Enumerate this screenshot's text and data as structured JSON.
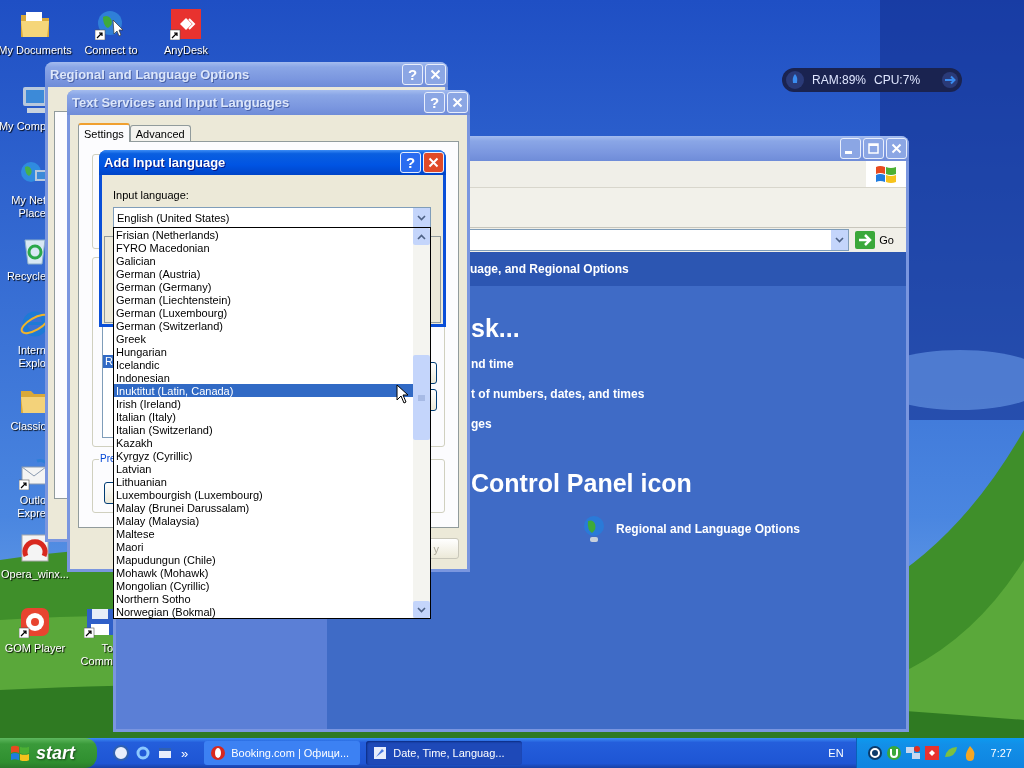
{
  "desktop_icons": [
    {
      "lines": [
        "My Documents"
      ],
      "kind": "documents",
      "shortcut": false
    },
    {
      "lines": [
        "Connect to"
      ],
      "kind": "connect",
      "shortcut": true
    },
    {
      "lines": [
        "AnyDesk"
      ],
      "kind": "anydesk",
      "shortcut": true
    },
    {
      "lines": [
        "My Comp"
      ],
      "kind": "computer",
      "shortcut": false
    },
    {
      "lines": [
        "My Net",
        "Place"
      ],
      "kind": "network",
      "shortcut": false
    },
    {
      "lines": [
        "Recycle"
      ],
      "kind": "recycle",
      "shortcut": false
    },
    {
      "lines": [
        "Intern",
        "Explo"
      ],
      "kind": "ie",
      "shortcut": false
    },
    {
      "lines": [
        "Classic"
      ],
      "kind": "folder",
      "shortcut": false
    },
    {
      "lines": [
        "Outlo",
        "Expre"
      ],
      "kind": "outlook",
      "shortcut": true
    },
    {
      "lines": [
        "Opera_winx..."
      ],
      "kind": "opera",
      "shortcut": false
    },
    {
      "lines": [
        "GOM Player"
      ],
      "kind": "gom",
      "shortcut": true
    },
    {
      "lines": [
        "To",
        "Comm"
      ],
      "kind": "commander",
      "shortcut": true
    }
  ],
  "system_monitor": {
    "ram": "RAM:89%",
    "cpu": "CPU:7%"
  },
  "control_panel_window": {
    "active": false,
    "go_button": "Go",
    "header": "uage, and Regional Options",
    "task_heading": "sk...",
    "tasks": [
      "nd time",
      "t of numbers, dates, and times",
      "ges"
    ],
    "icon_heading": "Control Panel icon",
    "icon_link": "Regional and Language Options"
  },
  "regional_window": {
    "title": "Regional and Language Options",
    "active": false,
    "help": "?"
  },
  "text_services_window": {
    "title": "Text Services and Input Languages",
    "active": false,
    "help": "?",
    "tabs": [
      {
        "label": "Settings",
        "selected": true
      },
      {
        "label": "Advanced",
        "selected": false
      }
    ],
    "installed_item": {
      "label": "R",
      "selected": true
    },
    "preferences_label": "Pre",
    "apply_button": {
      "label": "y",
      "disabled": true
    }
  },
  "add_dialog": {
    "title": "Add Input language",
    "active": true,
    "help": "?",
    "field_label": "Input language:",
    "value": "English (United States)",
    "options": [
      {
        "label": "Frisian (Netherlands)",
        "selected": false
      },
      {
        "label": "FYRO Macedonian",
        "selected": false
      },
      {
        "label": "Galician",
        "selected": false
      },
      {
        "label": "German (Austria)",
        "selected": false
      },
      {
        "label": "German (Germany)",
        "selected": false
      },
      {
        "label": "German (Liechtenstein)",
        "selected": false
      },
      {
        "label": "German (Luxembourg)",
        "selected": false
      },
      {
        "label": "German (Switzerland)",
        "selected": false
      },
      {
        "label": "Greek",
        "selected": false
      },
      {
        "label": "Hungarian",
        "selected": false
      },
      {
        "label": "Icelandic",
        "selected": false
      },
      {
        "label": "Indonesian",
        "selected": false
      },
      {
        "label": "Inuktitut (Latin, Canada)",
        "selected": true
      },
      {
        "label": "Irish (Ireland)",
        "selected": false
      },
      {
        "label": "Italian (Italy)",
        "selected": false
      },
      {
        "label": "Italian (Switzerland)",
        "selected": false
      },
      {
        "label": "Kazakh",
        "selected": false
      },
      {
        "label": "Kyrgyz (Cyrillic)",
        "selected": false
      },
      {
        "label": "Latvian",
        "selected": false
      },
      {
        "label": "Lithuanian",
        "selected": false
      },
      {
        "label": "Luxembourgish (Luxembourg)",
        "selected": false
      },
      {
        "label": "Malay (Brunei Darussalam)",
        "selected": false
      },
      {
        "label": "Malay (Malaysia)",
        "selected": false
      },
      {
        "label": "Maltese",
        "selected": false
      },
      {
        "label": "Maori",
        "selected": false
      },
      {
        "label": "Mapudungun (Chile)",
        "selected": false
      },
      {
        "label": "Mohawk (Mohawk)",
        "selected": false
      },
      {
        "label": "Mongolian (Cyrillic)",
        "selected": false
      },
      {
        "label": "Northern Sotho",
        "selected": false
      },
      {
        "label": "Norwegian (Bokmal)",
        "selected": false
      }
    ]
  },
  "taskbar": {
    "start": "start",
    "more": "»",
    "tasks": [
      {
        "label": "Booking.com | Офици...",
        "kind": "opera",
        "selected": false
      },
      {
        "label": "Date, Time, Languag...",
        "kind": "control-panel",
        "selected": true
      }
    ],
    "language": "EN",
    "clock": "7:27"
  }
}
